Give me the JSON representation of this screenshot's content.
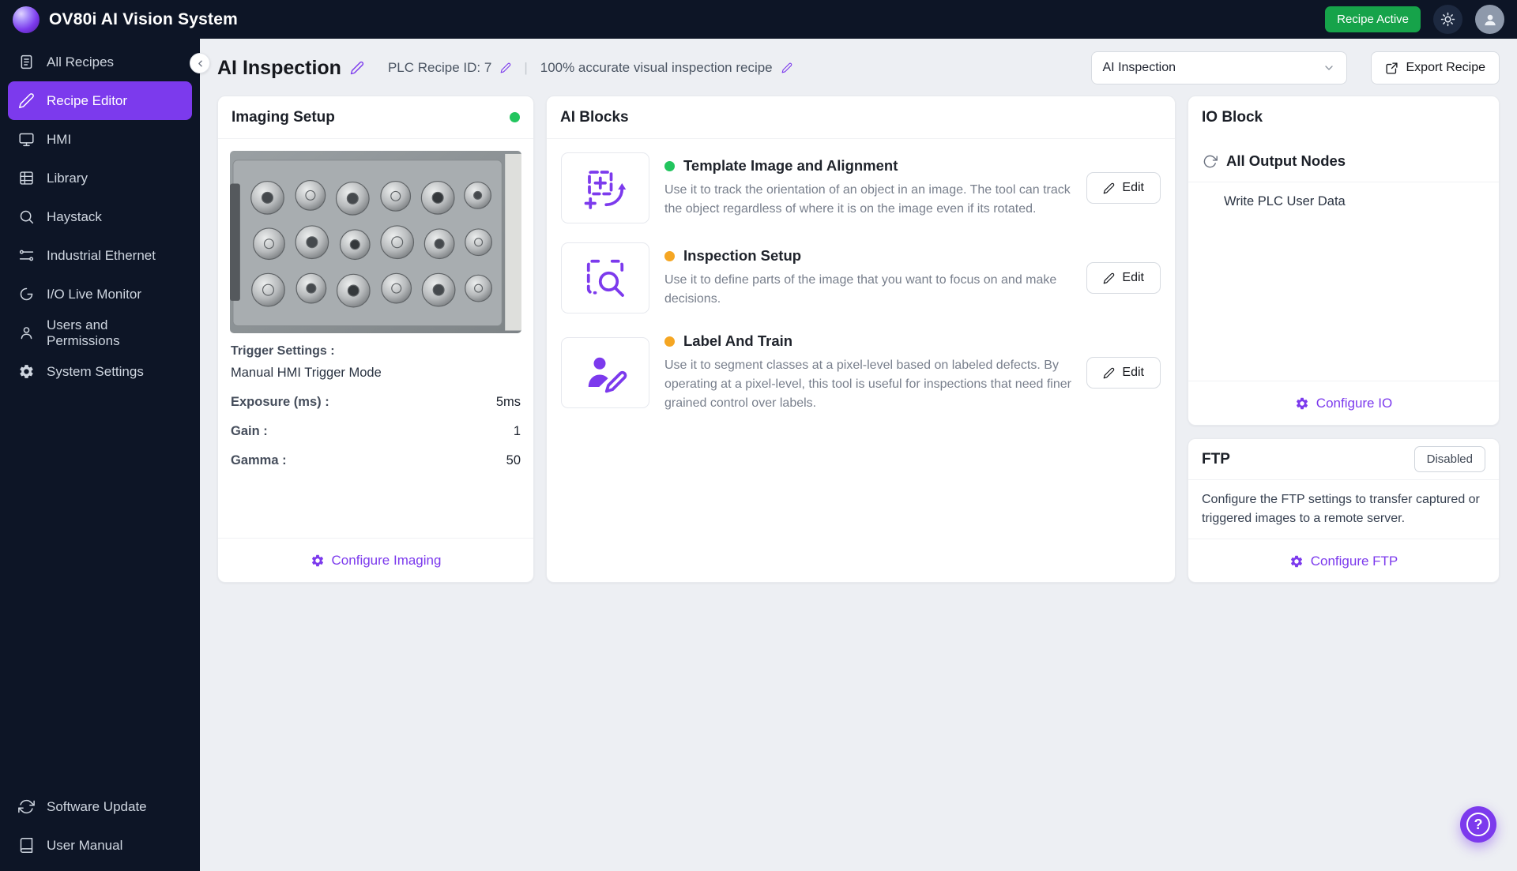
{
  "app": {
    "title": "OV80i AI Vision System",
    "status_badge": "Recipe Active",
    "help_label": "?"
  },
  "colors": {
    "accent_purple": "#7c3aed",
    "sidebar_bg": "#0d1526",
    "status_green": "#22c55e",
    "status_orange": "#f5a623",
    "badge_green_bg": "#16a34a",
    "main_bg": "#edeff3"
  },
  "sidebar": {
    "items": [
      {
        "label": "All Recipes",
        "icon": "recipes-icon",
        "active": false
      },
      {
        "label": "Recipe Editor",
        "icon": "pen-icon",
        "active": true
      },
      {
        "label": "HMI",
        "icon": "monitor-icon",
        "active": false
      },
      {
        "label": "Library",
        "icon": "grid-icon",
        "active": false
      },
      {
        "label": "Haystack",
        "icon": "search-icon",
        "active": false
      },
      {
        "label": "Industrial Ethernet",
        "icon": "ethernet-icon",
        "active": false
      },
      {
        "label": "I/O Live Monitor",
        "icon": "io-monitor-icon",
        "active": false
      },
      {
        "label": "Users and Permissions",
        "icon": "users-icon",
        "active": false
      },
      {
        "label": "System Settings",
        "icon": "gear-icon",
        "active": false
      }
    ],
    "footer_items": [
      {
        "label": "Software Update",
        "icon": "refresh-icon"
      },
      {
        "label": "User Manual",
        "icon": "book-icon"
      }
    ]
  },
  "header": {
    "title": "AI Inspection",
    "plc_recipe_id": "PLC Recipe ID: 7",
    "separator": "|",
    "description": "100% accurate visual inspection recipe",
    "recipe_select_value": "AI Inspection",
    "export_button": "Export Recipe"
  },
  "imaging": {
    "title": "Imaging Setup",
    "status": "green",
    "trigger_label": "Trigger Settings :",
    "trigger_value": "Manual HMI Trigger Mode",
    "rows": [
      {
        "label": "Exposure (ms) :",
        "value": "5ms"
      },
      {
        "label": "Gain :",
        "value": "1"
      },
      {
        "label": "Gamma :",
        "value": "50"
      }
    ],
    "configure_label": "Configure Imaging"
  },
  "ai_blocks": {
    "title": "AI Blocks",
    "edit_label": "Edit",
    "blocks": [
      {
        "title": "Template Image and Alignment",
        "status": "green",
        "description": "Use it to track the orientation of an object in an image. The tool can track the object regardless of where it is on the image even if its rotated."
      },
      {
        "title": "Inspection Setup",
        "status": "orange",
        "description": "Use it to define parts of the image that you want to focus on and make decisions."
      },
      {
        "title": "Label And Train",
        "status": "orange",
        "description": "Use it to segment classes at a pixel-level based on labeled defects. By operating at a pixel-level, this tool is useful for inspections that need finer grained control over labels."
      }
    ]
  },
  "io_block": {
    "title": "IO Block",
    "output_nodes_label": "All Output Nodes",
    "nodes": [
      "Write PLC User Data"
    ],
    "configure_label": "Configure IO"
  },
  "ftp": {
    "title": "FTP",
    "status_badge": "Disabled",
    "description": "Configure the FTP settings to transfer captured or triggered images to a remote server.",
    "configure_label": "Configure FTP"
  }
}
